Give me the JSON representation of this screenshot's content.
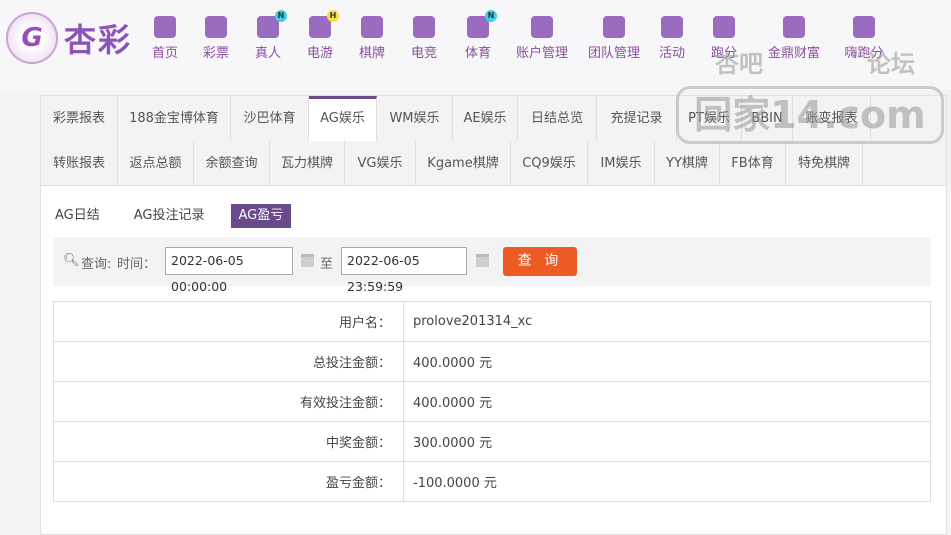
{
  "brand": {
    "name": "杏彩",
    "logo_letter": "G"
  },
  "nav": [
    {
      "label": "首页",
      "icon": "home-icon",
      "color": "#9b6bc0"
    },
    {
      "label": "彩票",
      "icon": "ticket-icon",
      "color": "#9b6bc0"
    },
    {
      "label": "真人",
      "icon": "live-dealer-icon",
      "badge": "N",
      "badge_color": "#3ad0e8"
    },
    {
      "label": "电游",
      "icon": "gamepad-icon",
      "badge": "H",
      "badge_color": "#f0e040"
    },
    {
      "label": "棋牌",
      "icon": "cards-icon"
    },
    {
      "label": "电竞",
      "icon": "gamepad-icon"
    },
    {
      "label": "体育",
      "icon": "trophy-icon",
      "badge": "N",
      "badge_color": "#3ad0e8"
    },
    {
      "label": "账户管理",
      "icon": "yen-coin-icon"
    },
    {
      "label": "团队管理",
      "icon": "team-icon"
    },
    {
      "label": "活动",
      "icon": "gift-icon"
    },
    {
      "label": "跑分",
      "icon": "car-icon"
    },
    {
      "label": "金鼎财富",
      "icon": "treasure-icon"
    },
    {
      "label": "嗨跑分",
      "icon": "hi-app-icon"
    }
  ],
  "tabs_row1": [
    "彩票报表",
    "188金宝博体育",
    "沙巴体育",
    "AG娱乐",
    "WM娱乐",
    "AE娱乐",
    "日结总览",
    "充提记录",
    "PT娱乐",
    "BBIN",
    "账变报表"
  ],
  "tabs_row2": [
    "转账报表",
    "返点总额",
    "余额查询",
    "瓦力棋牌",
    "VG娱乐",
    "Kgame棋牌",
    "CQ9娱乐",
    "IM娱乐",
    "YY棋牌",
    "FB体育",
    "特免棋牌"
  ],
  "active_tab": "AG娱乐",
  "subtabs": [
    "AG日结",
    "AG投注记录",
    "AG盈亏"
  ],
  "active_subtab": "AG盈亏",
  "search": {
    "query_label": "查询:",
    "time_label": "时间：",
    "start": "2022-06-05 00:00:00",
    "to": "至",
    "end": "2022-06-05 23:59:59",
    "button": "查 询"
  },
  "rows": [
    {
      "label": "用户名：",
      "value": "prolove201314_xc"
    },
    {
      "label": "总投注金额：",
      "value": "400.0000 元"
    },
    {
      "label": "有效投注金额：",
      "value": "400.0000 元"
    },
    {
      "label": "中奖金额：",
      "value": "300.0000 元"
    },
    {
      "label": "盈亏金额：",
      "value": "-100.0000 元"
    }
  ],
  "watermark": {
    "top_left": "杏吧",
    "top_right": "论坛",
    "main": "回家14.com"
  },
  "colors": {
    "accent": "#6a4a8a",
    "button": "#ee5a24",
    "nav_text": "#8a4f9e"
  }
}
